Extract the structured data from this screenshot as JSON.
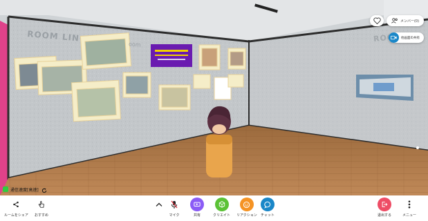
{
  "scene": {
    "wall_text_left": "ROOM LIN",
    "wall_text_left_tail": "oom",
    "wall_text_right": "ROOM"
  },
  "top_right": {
    "like_icon": "heart-icon",
    "members_label": "メンバー(0)",
    "camera_label": "他画面の共有"
  },
  "status": {
    "connection_text": "通信速度[高速]",
    "reload_icon": "reload-icon",
    "status_color": "#2ecc40"
  },
  "toolbar": {
    "left": [
      {
        "label": "ルームをシェア",
        "icon": "share-icon"
      },
      {
        "label": "おすすめ",
        "icon": "hand-pointer-icon"
      }
    ],
    "center": [
      {
        "label": "マイク",
        "icon": "mic-off-icon",
        "color": "#ffffff"
      },
      {
        "label": "共有",
        "icon": "screen-share-icon",
        "color": "#8b5cf6"
      },
      {
        "label": "クリエイト",
        "icon": "create-icon",
        "color": "#5bc236"
      },
      {
        "label": "リアクション",
        "icon": "smile-icon",
        "color": "#f59324"
      },
      {
        "label": "チャット",
        "icon": "chat-icon",
        "color": "#1a87c8"
      }
    ],
    "right": [
      {
        "label": "退出する",
        "icon": "exit-icon",
        "color": "#ee4d66"
      },
      {
        "label": "メニュー",
        "icon": "more-icon",
        "color": "#ffffff"
      }
    ],
    "expand_icon": "chevron-up-icon"
  }
}
